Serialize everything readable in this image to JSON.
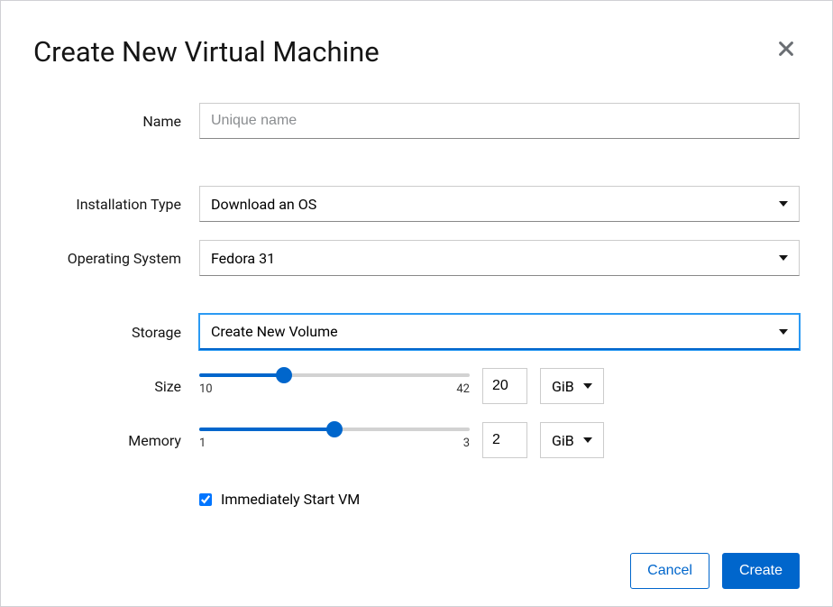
{
  "title": "Create New Virtual Machine",
  "fields": {
    "name": {
      "label": "Name",
      "placeholder": "Unique name",
      "value": ""
    },
    "install_type": {
      "label": "Installation Type",
      "value": "Download an OS"
    },
    "os": {
      "label": "Operating System",
      "value": "Fedora 31"
    },
    "storage": {
      "label": "Storage",
      "value": "Create New Volume"
    },
    "size": {
      "label": "Size",
      "value": "20",
      "unit": "GiB",
      "min": "10",
      "max": "42",
      "min_num": 10,
      "max_num": 42,
      "val_num": 20
    },
    "memory": {
      "label": "Memory",
      "value": "2",
      "unit": "GiB",
      "min": "1",
      "max": "3",
      "min_num": 1,
      "max_num": 3,
      "val_num": 2
    },
    "auto_start": {
      "label": "Immediately Start VM",
      "checked": true
    }
  },
  "buttons": {
    "cancel": "Cancel",
    "create": "Create"
  }
}
